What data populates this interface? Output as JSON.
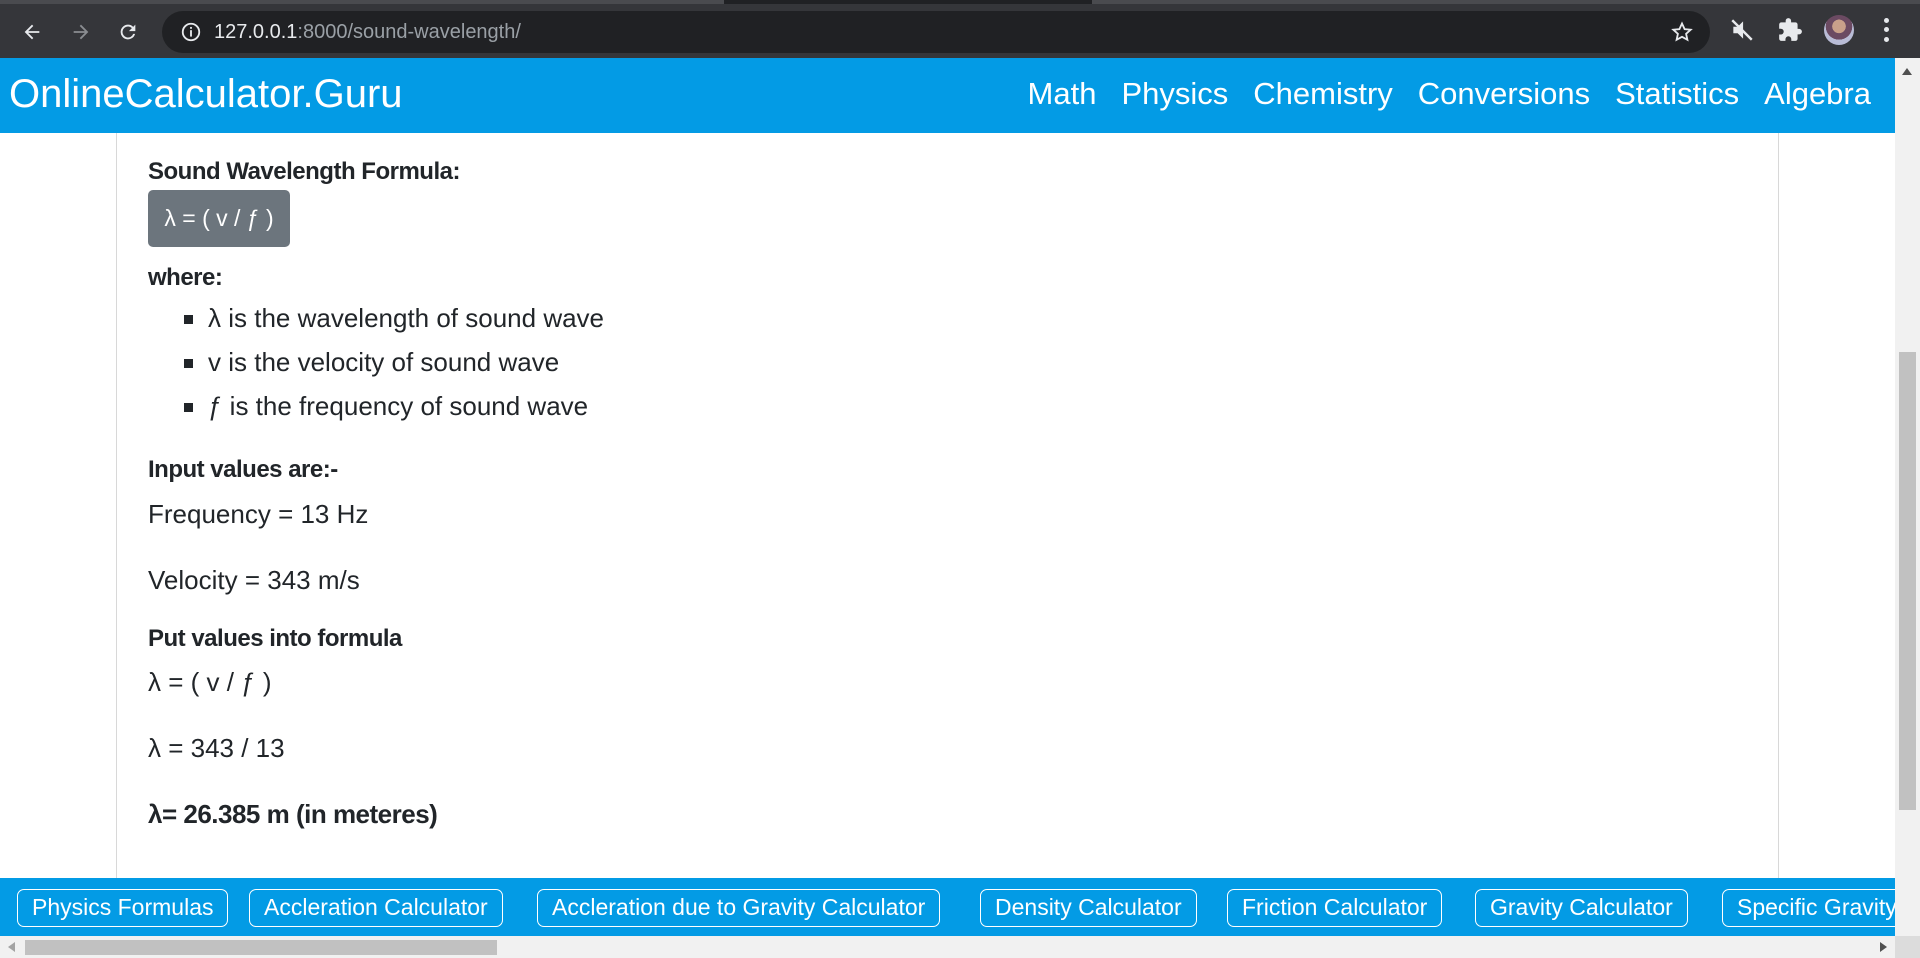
{
  "browser": {
    "url_host": "127.0.0.1",
    "url_rest": ":8000/sound-wavelength/"
  },
  "site": {
    "brand": "OnlineCalculator.Guru",
    "nav": [
      "Math",
      "Physics",
      "Chemistry",
      "Conversions",
      "Statistics",
      "Algebra"
    ]
  },
  "content": {
    "formula_heading": "Sound Wavelength Formula:",
    "formula": "λ = ( v / ƒ )",
    "where_label": "where:",
    "definitions": [
      "λ is the wavelength of sound wave",
      "v is the velocity of sound wave",
      "ƒ is the frequency of sound wave"
    ],
    "input_heading": "Input values are:-",
    "frequency_line": "Frequency = 13 Hz",
    "velocity_line": "Velocity = 343 m/s",
    "put_heading": "Put values into formula",
    "step1": "λ = ( v / ƒ )",
    "step2": "λ = 343 / 13",
    "result": "λ= 26.385 m (in meteres)"
  },
  "related": [
    "Physics Formulas",
    "Accleration Calculator",
    "Accleration due to Gravity Calculator",
    "Density Calculator",
    "Friction Calculator",
    "Gravity Calculator",
    "Specific Gravity"
  ],
  "colors": {
    "header_bg": "#039be5",
    "badge_bg": "#6c757d",
    "chrome_bg": "#35363a"
  }
}
